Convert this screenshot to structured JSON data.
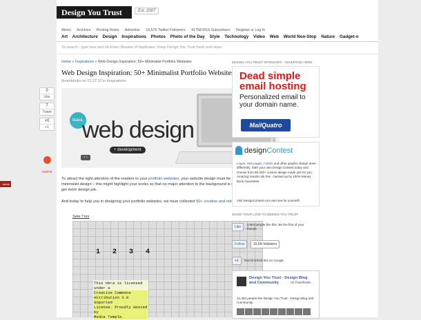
{
  "brand": {
    "logo": "Design You Trust",
    "est": "Est. 2007"
  },
  "topnav": [
    "About",
    "Archives",
    "Posting Rules",
    "Advertise",
    "16,575 Twitter Followers",
    "41758 RSS Subscribers",
    "Register or Log In"
  ],
  "catnav": [
    "Art",
    "Architecture",
    "Design",
    "Inspirations",
    "Photos",
    "Photo of the Day",
    "Style",
    "Technology",
    "Video",
    "Web",
    "World Non-Stop",
    "Nature",
    "Gadget-o"
  ],
  "search": {
    "placeholder": "To search - type here and hit Enter! Beware of duplicates. Keep Design You Trust fresh and clean."
  },
  "breadcrumb": {
    "home": "Home",
    "sep1": " » ",
    "section": "Inspirations",
    "sep2": " » ",
    "current": "Web Design Inspiration: 50+ Minimalist Portfolio Websites"
  },
  "post": {
    "title": "Web Design Inspiration: 50+ Minimalist Portfolio Websites",
    "meta": "tbranddudio on 01.27.12 in Inspirations",
    "hero": {
      "badge": "teava.",
      "headline": "web design",
      "tag": "+ development",
      "pager": "‹  ›"
    },
    "p1_a": "To attract the right attention of the readers to your ",
    "p1_link": "portfolio websites",
    "p1_b": ", your website design must be pretty and neat. Also use minimalist design – this might highlight your works so that no major attention to the background is needed. It will help you to get more design job.",
    "p2_a": "And today to help you in designing your portfolio websites, we have collected ",
    "p2_link": "50+ creative and minimalist portfolio websites",
    "p2_b": ".",
    "item_title": "Sete Tres",
    "shot_numbers": "1 2 3 4",
    "shot_license": [
      "This obra is licensed under a",
      "Creative Commons",
      "Attribution 3.0 Unported",
      "License. Proudly Hosted by",
      "Media Temple."
    ]
  },
  "share": {
    "like_count": "0",
    "like_label": "Like",
    "tweet_count": "7",
    "tweet_label": "Tweet",
    "plus_count": "+1",
    "plus_label": "+0",
    "submit_label": "Submit"
  },
  "side_tab": "wards",
  "sidebar": {
    "sponsors_label": "DESIGN YOU TRUST SPONSORS · ADVERTISE HERE",
    "ad1": {
      "line1": "Dead simple",
      "line2": "email hosting",
      "line3": "Personalized email to",
      "line4": "your domain name.",
      "brand": "MailQuatro"
    },
    "ad2": {
      "brand_a": "design",
      "brand_b": "Contest",
      "desc_links": "Logos, web pages, t-shirts",
      "desc": " and other graphic design done differently. Start your own Design Contest today and choose from 50-200+ custom design made just for you. Amazing results risk free - backed up by 100% Money Back Guarantee",
      "visit": "Visit DesignContest.com and see for yourself!"
    },
    "love_label": "SHOW YOUR LOVE TO DESIGN YOU TRUST",
    "fb": {
      "btn": "Like",
      "text": "3,864 people like this. Be the first of your friends."
    },
    "tw": {
      "btn": "Follow",
      "count": "16.5K followers"
    },
    "gp": {
      "btn": "+1",
      "text": "Recommend this on Google"
    },
    "fbbox": {
      "name": "Design You Trust - Design Blog and Community",
      "on": "on Facebook",
      "count": "44,454 people like Design You Trust - Design Blog and Community."
    }
  },
  "colors": {
    "accent": "#e01717",
    "link": "#2a5fa0",
    "facebook": "#3b5998",
    "brand_blue": "#2b9ac9"
  }
}
